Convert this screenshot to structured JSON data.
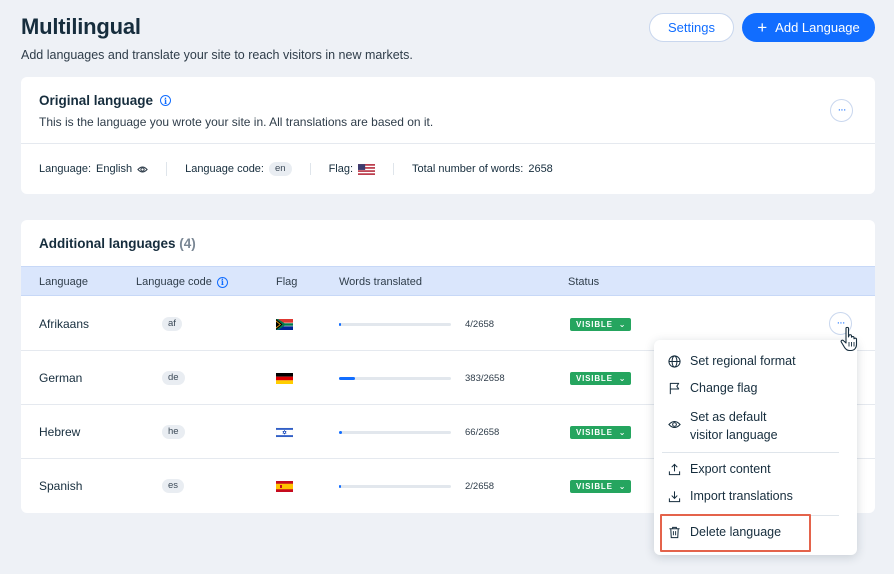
{
  "header": {
    "title": "Multilingual",
    "subtitle": "Add languages and translate your site to reach visitors in new markets.",
    "settings_label": "Settings",
    "add_language_label": "Add Language"
  },
  "original": {
    "title": "Original language",
    "description": "This is the language you wrote your site in. All translations are based on it.",
    "language_label": "Language:",
    "language_value": "English",
    "code_label": "Language code:",
    "code_value": "en",
    "flag_label": "Flag:",
    "flag_icon": "us-flag-icon",
    "words_label": "Total number of words:",
    "words_value": "2658"
  },
  "additional": {
    "title": "Additional languages",
    "count": "(4)",
    "columns": {
      "language": "Language",
      "code": "Language code",
      "flag": "Flag",
      "words": "Words translated",
      "status": "Status"
    },
    "rows": [
      {
        "language": "Afrikaans",
        "code": "af",
        "flag": "south-africa-flag-icon",
        "translated": 4,
        "total": 2658,
        "words": "4/2658",
        "status": "VISIBLE"
      },
      {
        "language": "German",
        "code": "de",
        "flag": "germany-flag-icon",
        "translated": 383,
        "total": 2658,
        "words": "383/2658",
        "status": "VISIBLE"
      },
      {
        "language": "Hebrew",
        "code": "he",
        "flag": "israel-flag-icon",
        "translated": 66,
        "total": 2658,
        "words": "66/2658",
        "status": "VISIBLE"
      },
      {
        "language": "Spanish",
        "code": "es",
        "flag": "spain-flag-icon",
        "translated": 2,
        "total": 2658,
        "words": "2/2658",
        "status": "VISIBLE"
      }
    ]
  },
  "menu": {
    "items": [
      {
        "label": "Set regional format",
        "icon": "globe-icon"
      },
      {
        "label": "Change flag",
        "icon": "flag-icon"
      },
      {
        "label": "Set as default visitor language",
        "icon": "eye-icon"
      },
      {
        "label": "Export content",
        "icon": "export-icon"
      },
      {
        "label": "Import translations",
        "icon": "import-icon"
      },
      {
        "label": "Delete language",
        "icon": "trash-icon"
      }
    ]
  },
  "colors": {
    "accent": "#116dff",
    "visible_badge": "#25a55f",
    "highlight": "#e4634b",
    "table_header": "#dae6fc"
  }
}
